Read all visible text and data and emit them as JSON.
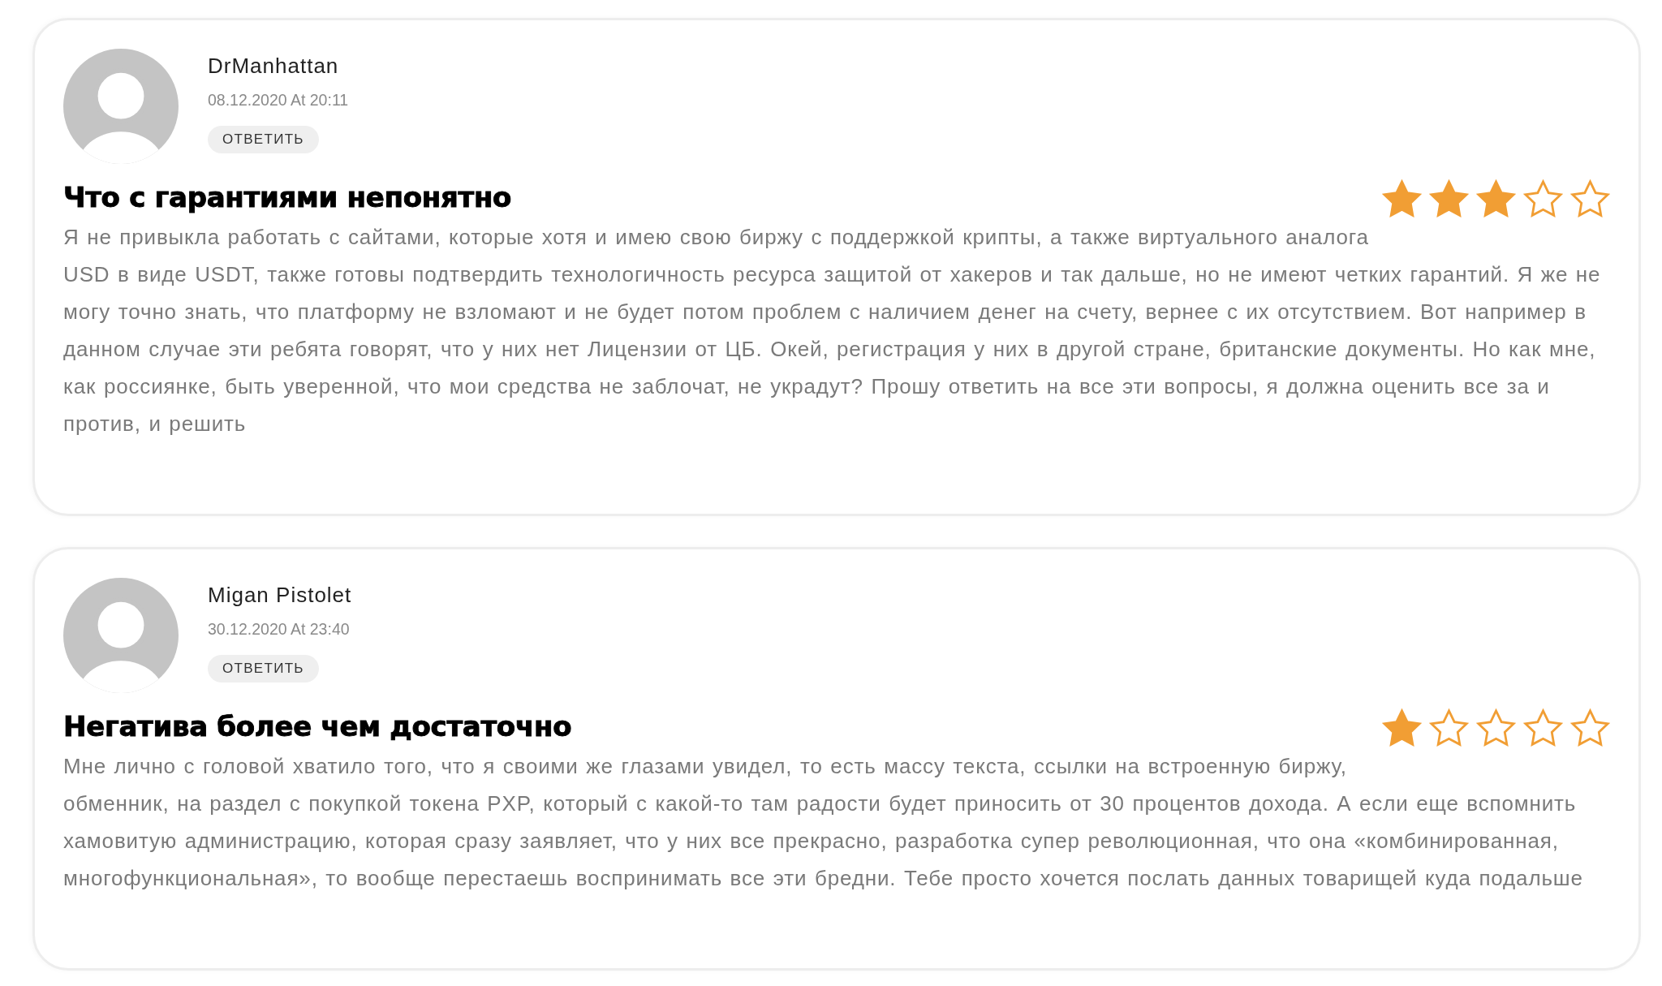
{
  "reviews": [
    {
      "author": "DrManhattan",
      "date": "08.12.2020 At 20:11",
      "reply_button": "ОТВЕТИТЬ",
      "title": "Что с гарантиями непонятно",
      "stars": 3,
      "text": "Я не привыкла работать с сайтами, которые хотя и имею свою биржу с поддержкой крипты, а также виртуального аналога USD в виде USDT, также готовы подтвердить технологичность ресурса защитой от хакеров и так дальше, но не имеют четких гарантий. Я же не могу точно знать, что платформу не взломают и не будет потом проблем с наличием денег на счету, вернее с их отсутствием. Вот например в данном случае эти ребята говорят, что у них нет Лицензии от ЦБ. Окей, регистрация у них в другой стране, британские документы. Но как мне, как россиянке, быть уверенной, что мои средства не заблочат, не украдут? Прошу ответить на все эти вопросы, я должна оценить все за и против, и решить"
    },
    {
      "author": "Migan Pistolet",
      "date": "30.12.2020 At 23:40",
      "reply_button": "ОТВЕТИТЬ",
      "title": "Негатива более чем достаточно",
      "stars": 1,
      "text": "Мне лично с головой хватило того, что я своими же глазами увидел, то есть массу текста, ссылки на встроенную биржу, обменник, на раздел с покупкой токена PXP, который с какой-то там радости будет приносить от 30 процентов дохода. А если еще вспомнить хамовитую администрацию, которая сразу заявляет, что у них все прекрасно, разработка супер революционная, что она «комбинированная, многофункциональная», то вообще перестаешь воспринимать все эти бредни. Тебе просто хочется послать данных товарищей куда подальше"
    }
  ]
}
